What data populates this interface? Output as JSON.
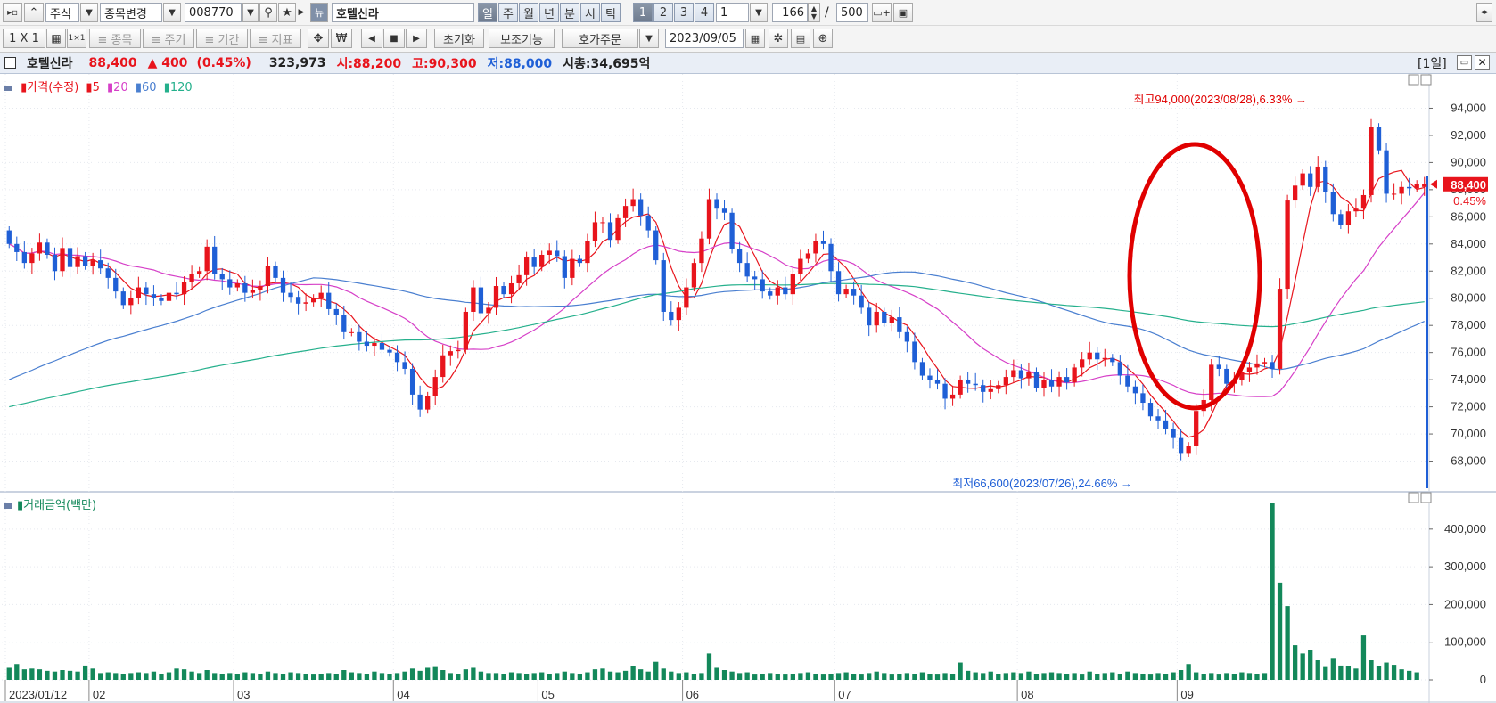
{
  "toolbar1": {
    "market_type": "주식",
    "change_label": "종목변경",
    "code": "008770",
    "stock_name": "호텔신라",
    "periods": [
      "일",
      "주",
      "월",
      "년",
      "분",
      "시",
      "틱"
    ],
    "numbers": [
      "1",
      "2",
      "3",
      "4"
    ],
    "unit_value": "1",
    "count_value": "166",
    "separator": "/",
    "total_value": "500"
  },
  "toolbar2": {
    "layout_label": "1 X 1",
    "stock_btn": "≡ 종목",
    "cycle_btn": "≡ 주기",
    "period_btn": "≡ 기간",
    "indicator_btn": "≡ 지표",
    "won_label": "₩",
    "reset_btn": "초기화",
    "aux_btn": "보조기능",
    "order_btn": "호가주문",
    "date_value": "2023/09/05"
  },
  "header": {
    "name": "호텔신라",
    "price": "88,400",
    "change": "▲ 400",
    "pct": "(0.45%)",
    "volume": "323,973",
    "open": "시:88,200",
    "high": "고:90,300",
    "low": "저:88,000",
    "mcap": "시총:34,695억",
    "period": "[1일]"
  },
  "colors": {
    "up": "#e8141c",
    "down": "#1f5fd6",
    "ma5": "#e8141c",
    "ma20": "#d640c8",
    "ma60": "#4a7fd0",
    "ma120": "#25b08c",
    "volume": "#13885a",
    "annotation": "#e00000"
  },
  "chart_data": [
    {
      "type": "candlestick",
      "title": "",
      "legend": [
        "가격(수정)",
        "5",
        "20",
        "60",
        "120"
      ],
      "x_tick_labels": [
        "2023/01/12",
        "02",
        "03",
        "04",
        "05",
        "06",
        "07",
        "08",
        "09"
      ],
      "y_ticks": [
        "94,000",
        "92,000",
        "90,000",
        "88,000",
        "86,000",
        "84,000",
        "82,000",
        "80,000",
        "78,000",
        "76,000",
        "74,000",
        "72,000",
        "70,000",
        "68,000"
      ],
      "ylim": [
        66000,
        96000
      ],
      "current_price": "88,400",
      "current_change": "0.45%",
      "high_label": "최고94,000(2023/08/28),6.33%",
      "low_label": "최저66,600(2023/07/26),24.66%",
      "closes": [
        84000,
        83400,
        82600,
        83300,
        84100,
        83200,
        82000,
        83700,
        82300,
        83100,
        82400,
        82800,
        82200,
        81500,
        80500,
        79500,
        80000,
        80800,
        80300,
        80000,
        79800,
        80400,
        80300,
        81200,
        81800,
        82000,
        83800,
        81800,
        81400,
        80800,
        81100,
        80400,
        80600,
        80900,
        82400,
        81500,
        80400,
        80100,
        79600,
        79700,
        80000,
        80400,
        79200,
        78800,
        77500,
        77500,
        76800,
        76500,
        76700,
        76200,
        76000,
        75300,
        74800,
        72900,
        71800,
        72800,
        74200,
        75800,
        76100,
        76200,
        79000,
        80800,
        78900,
        79300,
        80900,
        80300,
        81100,
        81700,
        83000,
        82300,
        83200,
        83500,
        83100,
        81500,
        82900,
        82600,
        84200,
        85600,
        85600,
        84300,
        85900,
        86800,
        87300,
        86100,
        85000,
        82800,
        79000,
        78400,
        79300,
        80800,
        82600,
        84400,
        87300,
        86600,
        86300,
        83600,
        82600,
        81600,
        81400,
        80500,
        80200,
        80800,
        80300,
        81800,
        82900,
        83300,
        84200,
        84000,
        82000,
        80300,
        80700,
        80200,
        79300,
        78000,
        79000,
        78200,
        78600,
        77500,
        76800,
        75300,
        74300,
        74000,
        73700,
        72600,
        72900,
        74000,
        73700,
        73600,
        73100,
        73300,
        73600,
        74200,
        74700,
        74100,
        74600,
        73400,
        74000,
        73500,
        74200,
        73800,
        74900,
        75500,
        76000,
        75500,
        75600,
        75300,
        74300,
        73500,
        73000,
        72300,
        71300,
        71000,
        70400,
        69700,
        68600,
        69100,
        71700,
        72500,
        75100,
        74800,
        73700,
        74000,
        74600,
        74900,
        75200,
        75300,
        74800,
        80700,
        87200,
        88300,
        89200,
        88200,
        89700,
        87800,
        86200,
        85400,
        86400,
        86600,
        87600,
        92600,
        90900,
        87700,
        87700,
        88200,
        88100,
        88400,
        88400
      ],
      "opens": [
        85000,
        84000,
        83400,
        82600,
        83300,
        84100,
        83200,
        82000,
        83700,
        82300,
        83100,
        82400,
        82800,
        82200,
        81500,
        80500,
        79500,
        80000,
        80800,
        80300,
        80000,
        79800,
        80400,
        80300,
        81200,
        81800,
        82000,
        83800,
        81800,
        81400,
        80800,
        81100,
        80400,
        80600,
        80900,
        82400,
        81500,
        80400,
        80100,
        79600,
        79700,
        80000,
        80400,
        79200,
        78800,
        77500,
        77500,
        76800,
        76500,
        76700,
        76200,
        76000,
        75300,
        74800,
        72900,
        71800,
        72800,
        74200,
        75800,
        76100,
        76200,
        79000,
        80800,
        78900,
        79300,
        80900,
        80300,
        81100,
        81700,
        83000,
        82300,
        83200,
        83500,
        83100,
        81500,
        82900,
        82600,
        84200,
        85600,
        85600,
        84300,
        85900,
        86800,
        87300,
        86100,
        85000,
        82800,
        79000,
        78400,
        79300,
        80800,
        82600,
        84400,
        87300,
        86600,
        86300,
        83600,
        82600,
        81600,
        81400,
        80500,
        80200,
        80800,
        80300,
        81800,
        82900,
        83300,
        84200,
        84000,
        82000,
        80300,
        80700,
        80200,
        79300,
        78000,
        79000,
        78200,
        78600,
        77500,
        76800,
        75300,
        74300,
        74000,
        73700,
        72600,
        72900,
        74000,
        73700,
        73600,
        73100,
        73300,
        73600,
        74200,
        74700,
        74100,
        74600,
        73400,
        74000,
        73500,
        74200,
        73800,
        74900,
        75500,
        76000,
        75500,
        75600,
        75300,
        74300,
        73500,
        73000,
        72300,
        71300,
        71000,
        70400,
        69700,
        68600,
        69100,
        71700,
        72500,
        75100,
        74800,
        73700,
        74000,
        74600,
        74900,
        75200,
        75300,
        74800,
        80700,
        87200,
        88300,
        89200,
        88200,
        89700,
        87800,
        86200,
        85400,
        86400,
        86600,
        87600,
        92600,
        90900,
        87700,
        87700,
        88200,
        88100,
        88200
      ]
    },
    {
      "type": "bar",
      "title": "",
      "legend": [
        "거래금액(백만)"
      ],
      "y_ticks": [
        "400,000",
        "300,000",
        "200,000",
        "100,000",
        "0"
      ],
      "ylim": [
        0,
        480000
      ],
      "values": [
        32000,
        42000,
        28000,
        30000,
        28000,
        24000,
        22000,
        26000,
        24000,
        22000,
        38000,
        30000,
        18000,
        20000,
        18000,
        16000,
        18000,
        20000,
        18000,
        22000,
        16000,
        20000,
        30000,
        28000,
        22000,
        18000,
        26000,
        18000,
        16000,
        18000,
        16000,
        20000,
        18000,
        16000,
        22000,
        18000,
        16000,
        20000,
        18000,
        16000,
        14000,
        16000,
        18000,
        16000,
        26000,
        20000,
        18000,
        16000,
        22000,
        18000,
        16000,
        18000,
        22000,
        30000,
        24000,
        32000,
        34000,
        26000,
        18000,
        16000,
        28000,
        32000,
        22000,
        18000,
        18000,
        16000,
        20000,
        18000,
        16000,
        18000,
        20000,
        16000,
        18000,
        22000,
        18000,
        16000,
        20000,
        28000,
        30000,
        22000,
        20000,
        24000,
        36000,
        28000,
        22000,
        48000,
        30000,
        22000,
        18000,
        20000,
        16000,
        18000,
        70000,
        32000,
        26000,
        22000,
        18000,
        20000,
        14000,
        16000,
        18000,
        16000,
        14000,
        16000,
        18000,
        20000,
        16000,
        14000,
        16000,
        18000,
        20000,
        16000,
        14000,
        18000,
        22000,
        18000,
        14000,
        16000,
        18000,
        16000,
        20000,
        16000,
        14000,
        18000,
        16000,
        46000,
        24000,
        20000,
        18000,
        22000,
        16000,
        18000,
        20000,
        18000,
        22000,
        16000,
        18000,
        20000,
        18000,
        16000,
        18000,
        14000,
        22000,
        16000,
        18000,
        20000,
        16000,
        22000,
        18000,
        16000,
        14000,
        18000,
        16000,
        20000,
        26000,
        42000,
        20000,
        16000,
        18000,
        14000,
        18000,
        16000,
        20000,
        18000,
        16000,
        18000,
        470000,
        258000,
        196000,
        92000,
        70000,
        80000,
        52000,
        34000,
        56000,
        38000,
        36000,
        30000,
        118000,
        52000,
        36000,
        46000,
        40000,
        28000,
        24000,
        20000
      ]
    }
  ]
}
